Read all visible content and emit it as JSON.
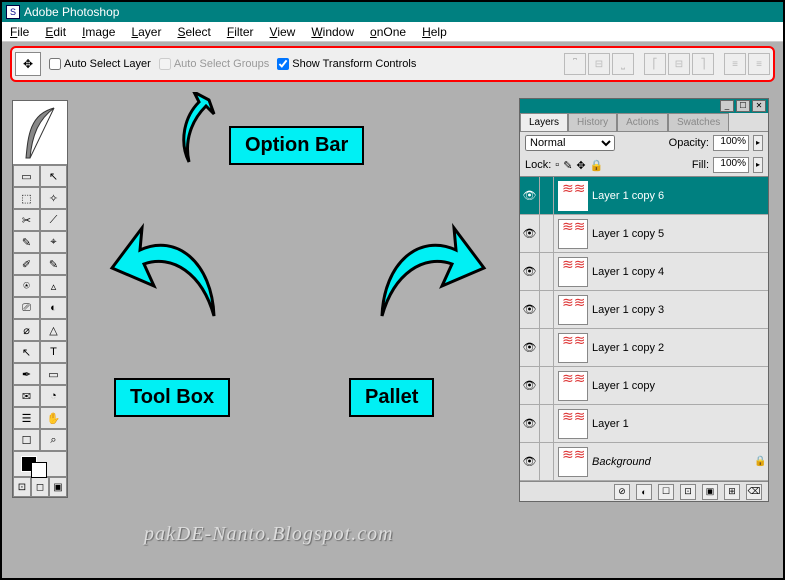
{
  "title": "Adobe Photoshop",
  "menu": [
    "File",
    "Edit",
    "Image",
    "Layer",
    "Select",
    "Filter",
    "View",
    "Window",
    "onOne",
    "Help"
  ],
  "optionbar": {
    "auto_select_layer": "Auto Select Layer",
    "auto_select_groups": "Auto Select Groups",
    "show_transform": "Show Transform Controls",
    "show_transform_checked": true
  },
  "callouts": {
    "optionbar": "Option Bar",
    "toolbox": "Tool Box",
    "pallet": "Pallet"
  },
  "toolbox": [
    [
      "▭",
      "↖"
    ],
    [
      "⬚",
      "✧"
    ],
    [
      "✂",
      "⟋"
    ],
    [
      "✎",
      "⌖"
    ],
    [
      "✐",
      "✎"
    ],
    [
      "⍟",
      "▵"
    ],
    [
      "⎚",
      "◐"
    ],
    [
      "⌀",
      "△"
    ],
    [
      "↖",
      "T"
    ],
    [
      "✒",
      "▭"
    ],
    [
      "✉",
      "◔"
    ],
    [
      "☰",
      "✋"
    ],
    [
      "☐",
      "⌕"
    ]
  ],
  "mini": [
    "⊡",
    "◻",
    "▣"
  ],
  "panel": {
    "tabs": [
      "Layers",
      "History",
      "Actions",
      "Swatches"
    ],
    "active_tab": 0,
    "blend": "Normal",
    "opacity_label": "Opacity:",
    "opacity_value": "100%",
    "lock_label": "Lock:",
    "fill_label": "Fill:",
    "fill_value": "100%",
    "layers": [
      {
        "name": "Layer 1 copy 6",
        "active": true
      },
      {
        "name": "Layer 1 copy 5"
      },
      {
        "name": "Layer 1 copy 4"
      },
      {
        "name": "Layer 1 copy 3"
      },
      {
        "name": "Layer 1 copy 2"
      },
      {
        "name": "Layer 1 copy"
      },
      {
        "name": "Layer 1"
      },
      {
        "name": "Background",
        "italic": true,
        "locked": true
      }
    ],
    "footer_icons": [
      "⊘",
      "◐",
      "☐",
      "⊡",
      "▣",
      "⊞",
      "⌫"
    ]
  },
  "watermark": "pakDE-Nanto.Blogspot.com"
}
